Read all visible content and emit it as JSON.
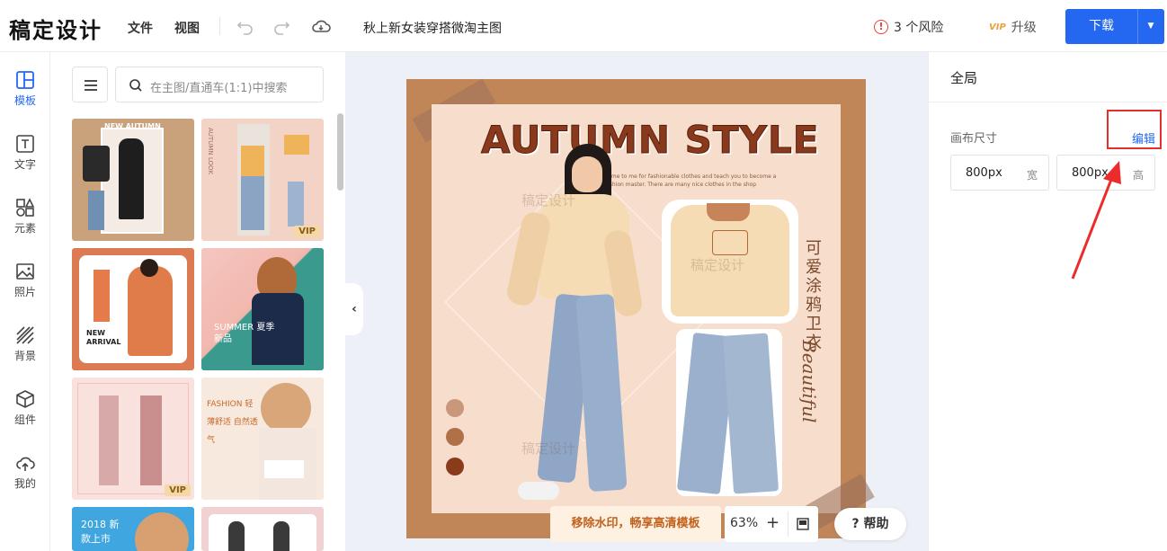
{
  "header": {
    "logo": "稿定设计",
    "menu": [
      "文件",
      "视图"
    ],
    "doc_title": "秋上新女装穿搭微淘主图",
    "risk_label": "3 个风险",
    "upgrade_label": "升级",
    "upgrade_badge": "VIP",
    "download_label": "下载",
    "icons": [
      "undo-icon",
      "redo-icon",
      "cloud-save-icon",
      "warning-icon",
      "chevron-down-icon"
    ]
  },
  "left_nav": {
    "items": [
      {
        "label": "模板",
        "icon": "template-icon",
        "active": true
      },
      {
        "label": "文字",
        "icon": "text-icon",
        "active": false
      },
      {
        "label": "元素",
        "icon": "shapes-icon",
        "active": false
      },
      {
        "label": "照片",
        "icon": "image-icon",
        "active": false
      },
      {
        "label": "背景",
        "icon": "background-icon",
        "active": false
      },
      {
        "label": "组件",
        "icon": "cube-icon",
        "active": false
      },
      {
        "label": "我的",
        "icon": "upload-cloud-icon",
        "active": false
      }
    ]
  },
  "templates": {
    "search_placeholder": "在主图/直通车(1:1)中搜索",
    "thumbs": [
      {
        "text": "NEW AUTUMN",
        "vip": false
      },
      {
        "text": "AUTUMN LOOK",
        "vip": true,
        "vip_label": "VIP"
      },
      {
        "text": "NEW ARRIVAL",
        "vip": false
      },
      {
        "text": "SUMMER 夏季新品",
        "vip": false
      },
      {
        "text": "",
        "vip": true,
        "vip_label": "VIP"
      },
      {
        "text": "FASHION 轻薄舒适 自然透气",
        "vip": false
      },
      {
        "text": "2018 新款上市",
        "vip": false
      },
      {
        "text": "",
        "vip": false
      }
    ]
  },
  "canvas": {
    "title": "AUTUMN STYLE",
    "subtitle": "Come to me for fashionable clothes and teach you to become a fashion master. There are many nice clothes in the shop",
    "vertical_text": "可爱涂鸦卫衣",
    "script_text": "Beautiful",
    "watermark": "稿定设计",
    "swatches": [
      "#c9977a",
      "#b07048",
      "#8a3b1a"
    ],
    "zoom": "63%",
    "remove_watermark_label": "移除水印，畅享高清模板",
    "help_label": "? 帮助"
  },
  "right_panel": {
    "title": "全局",
    "canvas_size_label": "画布尺寸",
    "edit_label": "编辑",
    "width_value": "800px",
    "width_unit": "宽",
    "height_value": "800px",
    "height_unit": "高"
  },
  "colors": {
    "accent": "#2468f2",
    "annotation_red": "#e62e2e",
    "canvas_frame": "#c08658",
    "canvas_bg": "#f7ddcb",
    "title": "#8a3a1c"
  }
}
